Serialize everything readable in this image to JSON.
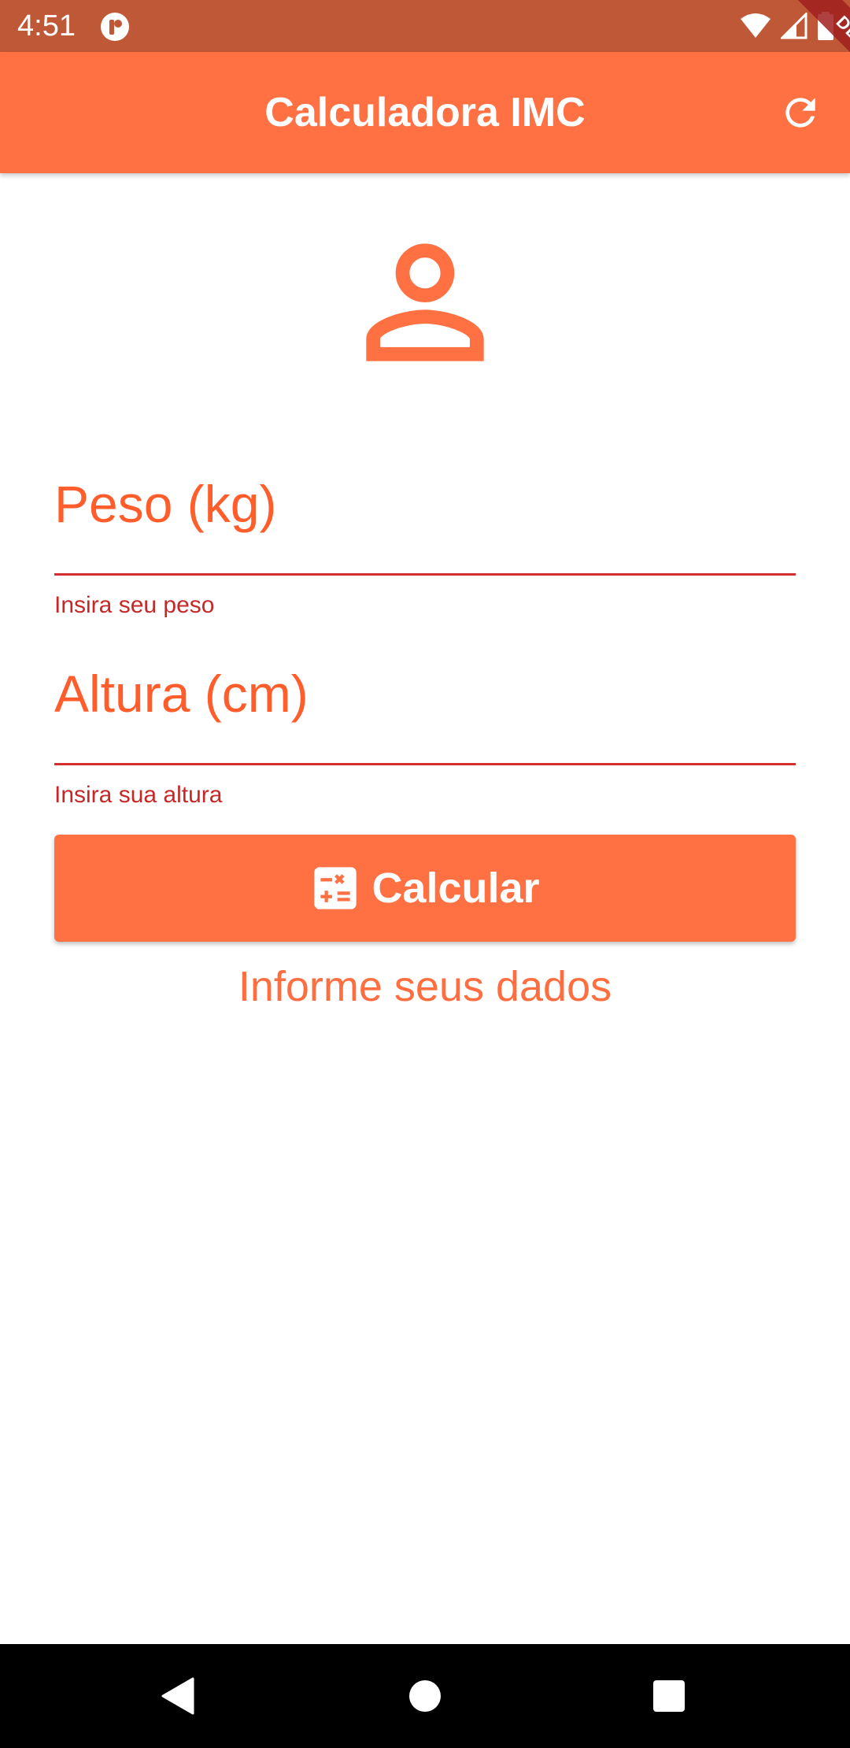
{
  "status_bar": {
    "time": "4:51",
    "icons": [
      "app-notification-icon",
      "wifi-icon",
      "signal-icon",
      "battery-icon"
    ]
  },
  "debug_banner": "DEBUG",
  "app_bar": {
    "title": "Calculadora IMC",
    "action_icon": "refresh-icon",
    "color": "#ff7043"
  },
  "avatar_icon": "person-outline-icon",
  "form": {
    "weight": {
      "label": "Peso (kg)",
      "value": "",
      "helper": "Insira seu peso"
    },
    "height": {
      "label": "Altura (cm)",
      "value": "",
      "helper": "Insira sua altura"
    }
  },
  "calculate_button": {
    "label": "Calcular",
    "icon": "calculator-icon"
  },
  "result": {
    "text": "Informe seus dados"
  },
  "nav_bar": {
    "buttons": [
      "back-icon",
      "home-icon",
      "recents-icon"
    ]
  },
  "colors": {
    "primary": "#ff7043",
    "status_bar": "#bf5836",
    "error": "#d32f2f",
    "label": "#ff5e2c"
  }
}
